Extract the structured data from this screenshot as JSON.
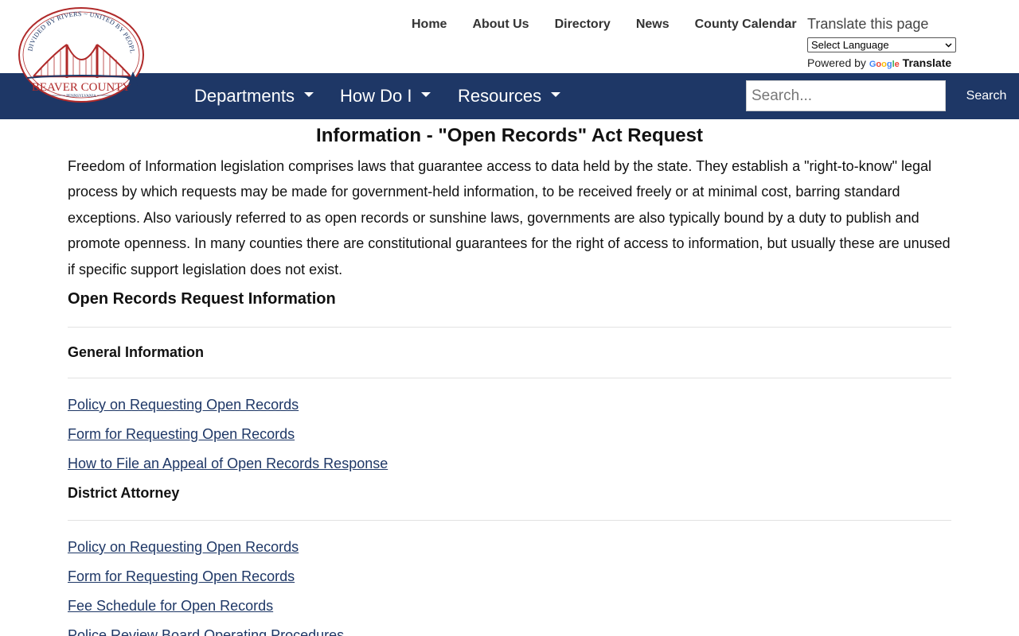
{
  "logo": {
    "arc_text": "DIVIDED BY RIVERS ~ UNITED BY PEOPLE",
    "name": "BEAVER COUNTY",
    "state": "PENNSYLVANIA",
    "colors": {
      "red": "#b02a2a",
      "navy": "#1e3766"
    }
  },
  "top_nav": [
    "Home",
    "About Us",
    "Directory",
    "News",
    "County Calendar"
  ],
  "translate": {
    "title": "Translate this page",
    "select_value": "Select Language",
    "powered_by": "Powered by",
    "google": "Google",
    "translate_word": "Translate"
  },
  "main_nav": {
    "items": [
      "Departments",
      "How Do I",
      "Resources"
    ],
    "search_placeholder": "Search...",
    "search_button": "Search",
    "bar_color": "#1e3766"
  },
  "content": {
    "title": "Information - \"Open Records\" Act Request",
    "intro": "Freedom of Information legislation comprises laws that guarantee access to data held by the state. They establish a \"right-to-know\" legal process by which requests may be made for government-held information, to be received freely or at minimal cost, barring standard exceptions. Also variously referred to as open records or sunshine laws, governments are also typically bound by a duty to publish and promote openness. In many counties there are constitutional guarantees for the right of access to information, but usually these are unused if specific support legislation does not exist.",
    "section_heading": "Open Records Request Information",
    "general": {
      "heading": "General Information",
      "links": [
        "Policy on Requesting Open Records",
        "Form for Requesting Open Records",
        "How to File an Appeal of Open Records Response"
      ]
    },
    "district_attorney": {
      "heading": "District Attorney",
      "links": [
        "Policy on Requesting Open Records",
        "Form for Requesting Open Records",
        "Fee Schedule for Open Records",
        "Police Review Board Operating Procedures"
      ]
    }
  }
}
